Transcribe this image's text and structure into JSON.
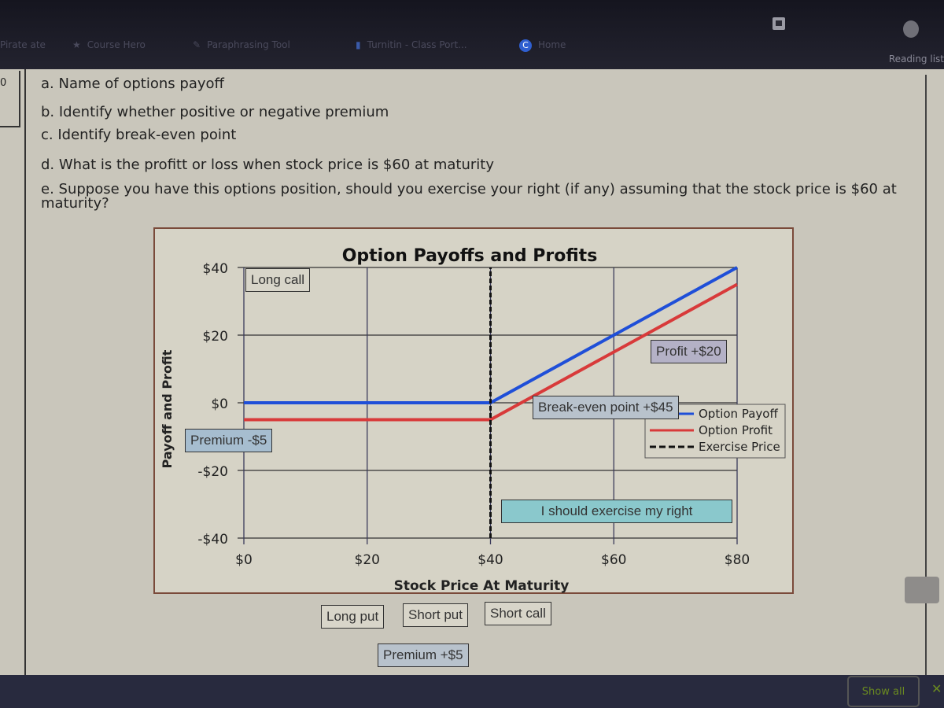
{
  "browser": {
    "bookmarks": [
      {
        "label": "Pirate ate",
        "icon": "bookmark-icon"
      },
      {
        "label": "Course Hero",
        "icon": "star-icon"
      },
      {
        "label": "Paraphrasing Tool",
        "icon": "pen-icon"
      },
      {
        "label": "Turnitin - Class Port...",
        "icon": "document-icon"
      },
      {
        "label": "Home",
        "icon": "c-logo-icon"
      }
    ],
    "reading_list": "Reading list",
    "show_all": "Show all",
    "close": "✕",
    "left_fragment": "0"
  },
  "questions": [
    "a. Name of options payoff",
    "b. Identify whether positive or negative premium",
    "c. Identify break-even point",
    "d. What is the profitt or loss when stock price is $60 at maturity",
    "e. Suppose you have this options position, should you exercise your right (if any) assuming that the stock price is $60 at",
    "maturity?"
  ],
  "annotations": {
    "long_call": "Long call",
    "premium_neg": "Premium -$5",
    "profit": "Profit +$20",
    "break_even": "Break-even point +$45",
    "exercise": "I should exercise my right",
    "long_put": "Long put",
    "short_put": "Short put",
    "short_call": "Short call",
    "premium_pos": "Premium +$5"
  },
  "chart_data": {
    "type": "line",
    "title": "Option Payoffs and Profits",
    "xlabel": "Stock Price At Maturity",
    "ylabel": "Payoff and Profit",
    "xlim": [
      0,
      80
    ],
    "ylim": [
      -40,
      40
    ],
    "x_ticks": [
      0,
      20,
      40,
      60,
      80
    ],
    "x_tick_labels": [
      "$0",
      "$20",
      "$40",
      "$60",
      "$80"
    ],
    "y_ticks": [
      40,
      20,
      0,
      -20,
      -40
    ],
    "y_tick_labels": [
      "$40",
      "$20",
      "$0",
      "-$20",
      "-$40"
    ],
    "grid": true,
    "legend_position": "center-right",
    "series": [
      {
        "name": "Option Payoff",
        "color": "#1f4fd8",
        "style": "solid",
        "x": [
          0,
          40,
          80
        ],
        "y": [
          0,
          0,
          40
        ]
      },
      {
        "name": "Option Profit",
        "color": "#d83a3a",
        "style": "solid",
        "x": [
          0,
          40,
          80
        ],
        "y": [
          -5,
          -5,
          35
        ]
      },
      {
        "name": "Exercise Price",
        "color": "#111111",
        "style": "dashed",
        "x": [
          40,
          40
        ],
        "y": [
          -40,
          40
        ]
      }
    ]
  }
}
